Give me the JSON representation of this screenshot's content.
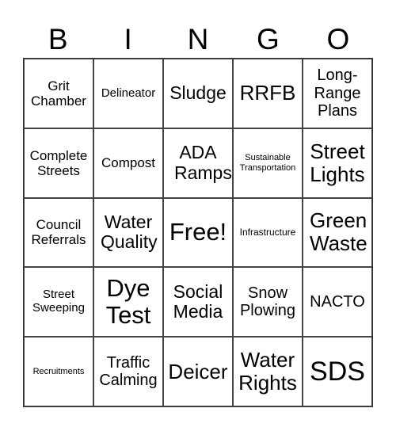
{
  "header": {
    "letters": [
      "B",
      "I",
      "N",
      "G",
      "O"
    ]
  },
  "cells": [
    [
      "Grit Chamber",
      "Delineator",
      "Sludge",
      "RRFB",
      "Long-Range Plans"
    ],
    [
      "Complete Streets",
      "Compost",
      "ADA Ramps",
      "Sustainable Transportation",
      "Street Lights"
    ],
    [
      "Council Referrals",
      "Water Quality",
      "Free!",
      "Infrastructure",
      "Green Waste"
    ],
    [
      "Street Sweeping",
      "Dye Test",
      "Social Media",
      "Snow Plowing",
      "NACTO"
    ],
    [
      "Recruitments",
      "Traffic Calming",
      "Deicer",
      "Water Rights",
      "SDS"
    ]
  ],
  "free_space": {
    "label": "Free!",
    "row": 2,
    "col": 2
  },
  "colors": {
    "border": "#333333",
    "text": "#000000",
    "background": "#ffffff"
  }
}
